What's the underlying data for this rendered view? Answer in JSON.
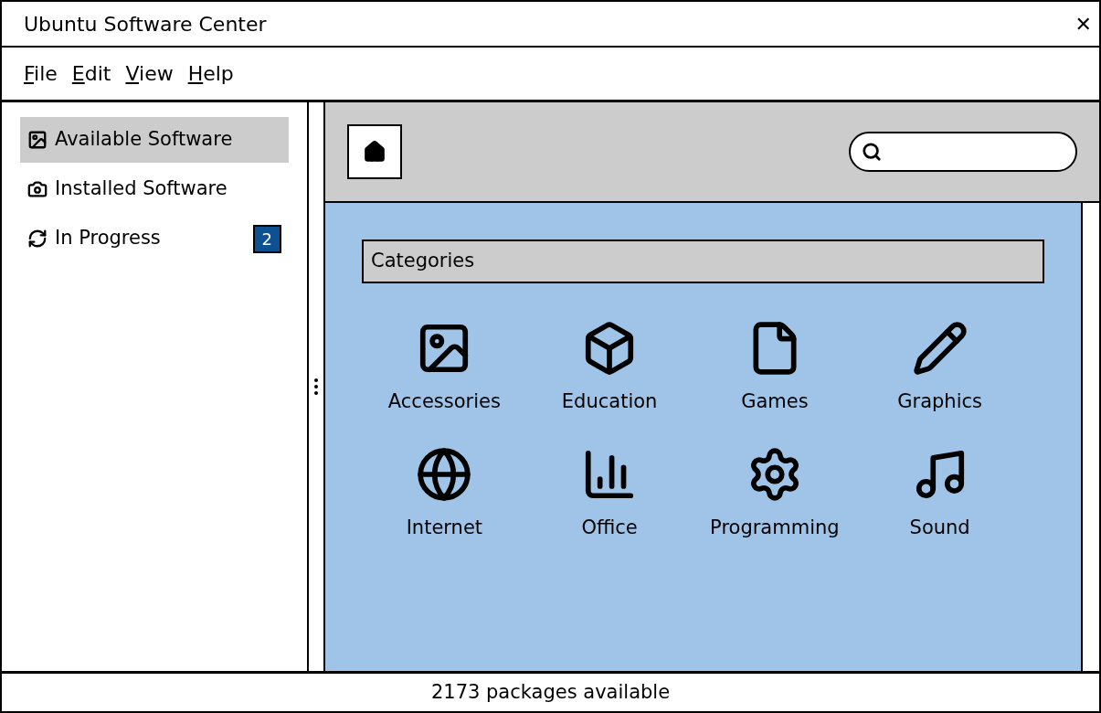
{
  "window": {
    "title": "Ubuntu Software Center",
    "close": "✕"
  },
  "menu": [
    {
      "label": "File"
    },
    {
      "label": "Edit"
    },
    {
      "label": "View"
    },
    {
      "label": "Help"
    }
  ],
  "sidebar": {
    "items": [
      {
        "label": "Available Software",
        "kind": "image",
        "selected": true
      },
      {
        "label": "Installed Software",
        "kind": "camera",
        "selected": false
      },
      {
        "label": "In Progress",
        "kind": "sync",
        "selected": false,
        "badge": "2"
      }
    ]
  },
  "categories_header": "Categories",
  "categories": [
    {
      "label": "Accessories",
      "kind": "image"
    },
    {
      "label": "Education",
      "kind": "cube"
    },
    {
      "label": "Games",
      "kind": "document"
    },
    {
      "label": "Graphics",
      "kind": "pencil"
    },
    {
      "label": "Internet",
      "kind": "globe"
    },
    {
      "label": "Office",
      "kind": "chart"
    },
    {
      "label": "Programming",
      "kind": "gear"
    },
    {
      "label": "Sound",
      "kind": "music"
    }
  ],
  "status_bar": "2173 packages available"
}
